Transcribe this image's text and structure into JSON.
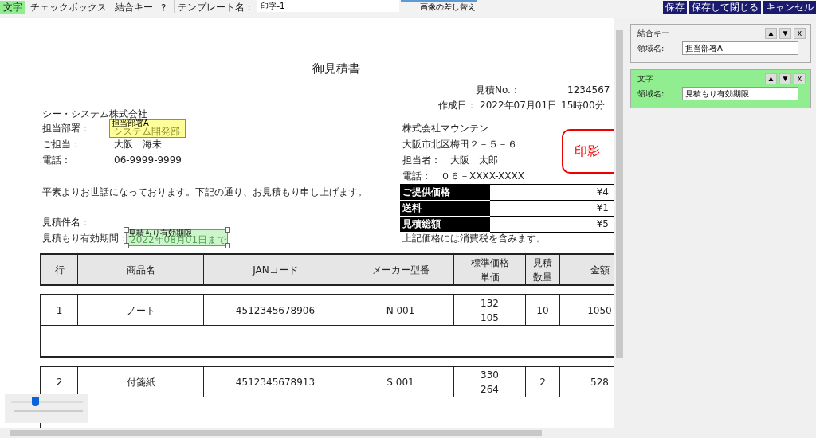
{
  "toolbar": {
    "tabs": [
      {
        "label": "文字",
        "selected": true
      },
      {
        "label": "チェックボックス",
        "selected": false
      },
      {
        "label": "結合キー",
        "selected": false
      },
      {
        "label": "?",
        "selected": false
      }
    ],
    "template_label": "テンプレート名：",
    "template_name": "印字-1",
    "replace_image_button": "画像の差し替え",
    "buttons": [
      "保存",
      "保存して閉じる",
      "キャンセル"
    ]
  },
  "document": {
    "title": "御見積書",
    "estimate_no_label": "見積No.：",
    "estimate_no": "1234567",
    "created_label": "作成日：",
    "created_date": "2022年07月01日",
    "created_time": "15時00分",
    "customer_company": "シー・システム株式会社",
    "customer_rows": [
      {
        "label": "担当部署：",
        "value": ""
      },
      {
        "label": "ご担当：",
        "value": "大阪　海未"
      },
      {
        "label": "電話：",
        "value": "06-9999-9999"
      }
    ],
    "greeting": "平素よりお世話になっております。下記の通り、お見積もり申し上げます。",
    "subject_label": "見積件名：",
    "validity_label": "見積もり有効期間：",
    "supplier_lines": [
      "株式会社マウンテン",
      "大阪市北区梅田２－５－６",
      "担当者：　大阪　太郎",
      "電話：　０６－XXXX-XXXX"
    ],
    "stamp_text": "印影",
    "totals": [
      {
        "label": "ご提供価格",
        "value": "¥4"
      },
      {
        "label": "送料",
        "value": "¥1"
      },
      {
        "label": "見積総額",
        "value": "¥5"
      }
    ],
    "tax_note": "上記価格には消費税を含みます。",
    "fields": [
      {
        "kind": "join_key",
        "name": "担当部署A",
        "value": "システム開発部",
        "selected": false
      },
      {
        "kind": "text",
        "name": "見積もり有効期限",
        "value": "2022年08月01日まで",
        "selected": true
      }
    ],
    "table": {
      "columns": [
        {
          "label": "行"
        },
        {
          "label": "商品名"
        },
        {
          "label": "JANコード"
        },
        {
          "label": "メーカー型番"
        },
        {
          "label": "標準価格",
          "sublabel": "単価"
        },
        {
          "label": "見積",
          "sublabel": "数量"
        },
        {
          "label": "金額"
        }
      ],
      "rows": [
        {
          "cells": [
            {
              "text": "1"
            },
            {
              "text": "ノート"
            },
            {
              "text": "4512345678906"
            },
            {
              "text": "N 001"
            },
            {
              "text": "132",
              "sub": "105"
            },
            {
              "text": "10"
            },
            {
              "text": "1050"
            }
          ]
        },
        {
          "cells": [
            {
              "text": "2"
            },
            {
              "text": "付箋紙"
            },
            {
              "text": "4512345678913"
            },
            {
              "text": "S 001"
            },
            {
              "text": "330",
              "sub": "264"
            },
            {
              "text": "2"
            },
            {
              "text": "528"
            }
          ]
        }
      ]
    }
  },
  "panel": {
    "cards": [
      {
        "kind": "join_key",
        "title": "結合キー",
        "up": "▲",
        "down": "▼",
        "remove": "x",
        "field_label": "領域名:",
        "field_value": "担当部署A"
      },
      {
        "kind": "text",
        "title": "文字",
        "up": "▲",
        "down": "▼",
        "remove": "x",
        "field_label": "領域名:",
        "field_value": "見積もり有効期限"
      }
    ]
  },
  "zoom_slider": {
    "level": 0.33
  }
}
